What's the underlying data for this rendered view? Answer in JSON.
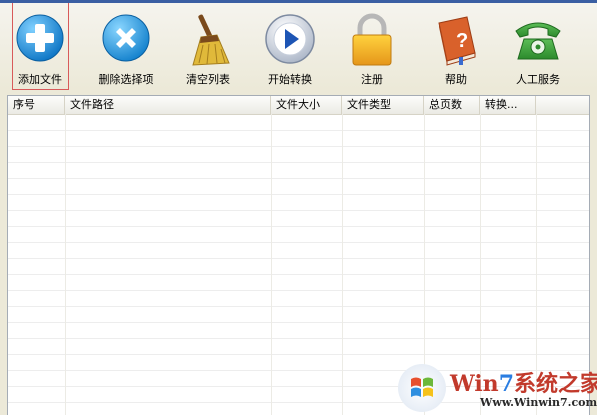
{
  "toolbar": {
    "buttons": [
      {
        "label": "添加文件",
        "icon": "add-plus-icon"
      },
      {
        "label": "删除选择项",
        "icon": "delete-x-icon"
      },
      {
        "label": "清空列表",
        "icon": "broom-icon"
      },
      {
        "label": "开始转换",
        "icon": "play-icon"
      },
      {
        "label": "注册",
        "icon": "lock-icon"
      },
      {
        "label": "帮助",
        "icon": "help-book-icon"
      },
      {
        "label": "人工服务",
        "icon": "telephone-icon"
      }
    ]
  },
  "file_list": {
    "columns": [
      "序号",
      "文件路径",
      "文件大小",
      "文件类型",
      "总页数",
      "转换..."
    ],
    "rows": []
  },
  "watermark": {
    "brand_parts": [
      "Win",
      "7",
      "系统之家"
    ],
    "url": "Www.Winwin7.com"
  },
  "colors": {
    "window_bg": "#ece9d8",
    "accent_blue": "#1f8fd8",
    "watermark_red": "#c23a2c"
  }
}
